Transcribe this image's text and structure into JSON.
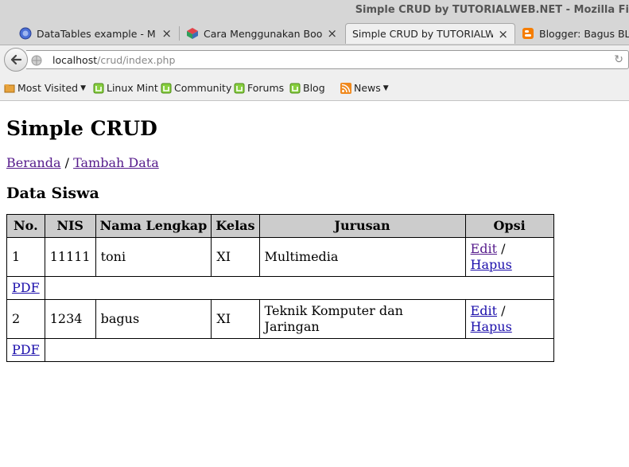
{
  "window": {
    "title": "Simple CRUD by TUTORIALWEB.NET - Mozilla Fi"
  },
  "tabs": [
    {
      "label": "DataTables example - M...",
      "active": false
    },
    {
      "label": "Cara Menggunakan Boot...",
      "active": false
    },
    {
      "label": "Simple CRUD by TUTORIALW...",
      "active": true
    },
    {
      "label": "Blogger: Bagus BLC T",
      "active": false
    }
  ],
  "address": {
    "host": "localhost",
    "path": "/crud/index.php"
  },
  "bookmarks": [
    "Most Visited",
    "Linux Mint",
    "Community",
    "Forums",
    "Blog",
    "News"
  ],
  "page": {
    "heading": "Simple CRUD",
    "nav": {
      "home": "Beranda",
      "separator": "/",
      "add": "Tambah Data"
    },
    "subheading": "Data Siswa",
    "table": {
      "headers": [
        "No.",
        "NIS",
        "Nama Lengkap",
        "Kelas",
        "Jurusan",
        "Opsi"
      ],
      "rows": [
        {
          "no": "1",
          "nis": "11111",
          "nama": "toni",
          "kelas": "XI",
          "jurusan": "Multimedia",
          "edit": "Edit",
          "sep": "/",
          "hapus": "Hapus",
          "pdf": "PDF"
        },
        {
          "no": "2",
          "nis": "1234",
          "nama": "bagus",
          "kelas": "XI",
          "jurusan": "Teknik Komputer dan Jaringan",
          "edit": "Edit",
          "sep": "/",
          "hapus": "Hapus",
          "pdf": "PDF"
        }
      ]
    }
  },
  "colors": {
    "link": "#1a0dab",
    "visited_link": "#551a8b",
    "header_bg": "#cccccc"
  }
}
